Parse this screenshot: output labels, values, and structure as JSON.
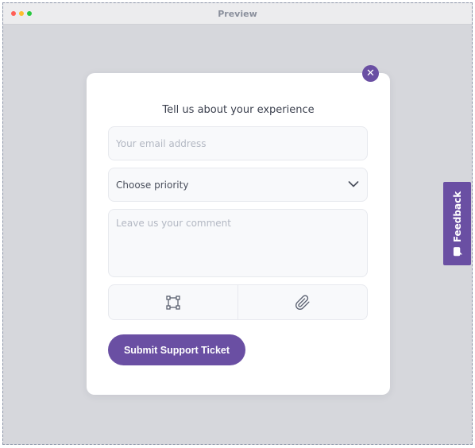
{
  "window": {
    "title": "Preview"
  },
  "modal": {
    "title": "Tell us about your experience",
    "email_placeholder": "Your email address",
    "priority_label": "Choose priority",
    "comment_placeholder": "Leave us your comment",
    "submit_label": "Submit Support Ticket"
  },
  "icons": {
    "close": "close-icon",
    "chevron": "chevron-down-icon",
    "screenshot": "screenshot-crop-icon",
    "attachment": "paperclip-icon",
    "feedback": "chat-bubble-icon"
  },
  "feedback_tab": {
    "label": "Feedback"
  },
  "colors": {
    "accent": "#6a4fa3",
    "background": "#d6d7dc",
    "field_bg": "#f8f9fb"
  }
}
